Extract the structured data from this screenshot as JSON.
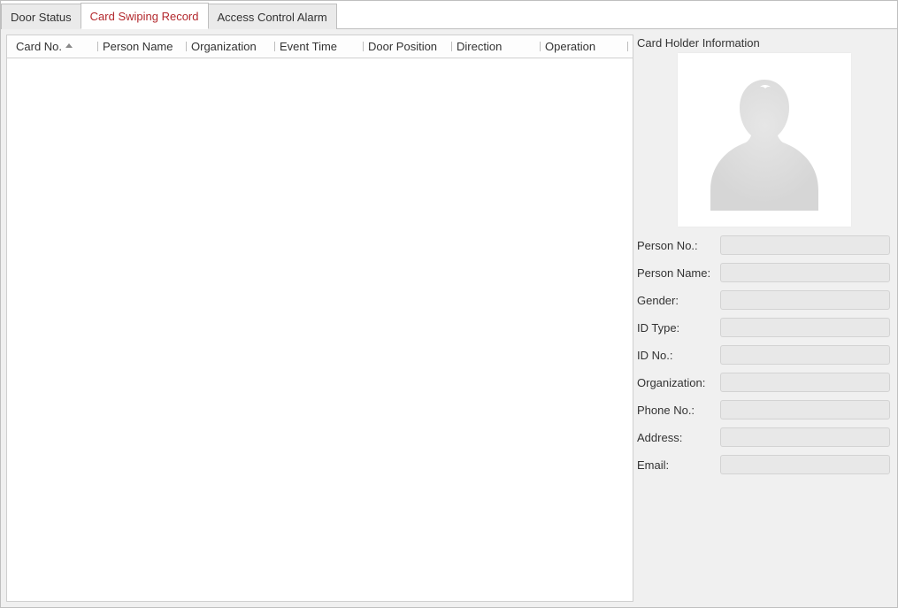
{
  "tabs": {
    "items": [
      {
        "label": "Door Status",
        "active": false
      },
      {
        "label": "Card Swiping Record",
        "active": true
      },
      {
        "label": "Access Control Alarm",
        "active": false
      }
    ]
  },
  "table": {
    "columns": [
      {
        "label": "Card No.",
        "sorted": true
      },
      {
        "label": "Person Name"
      },
      {
        "label": "Organization"
      },
      {
        "label": "Event Time"
      },
      {
        "label": "Door Position"
      },
      {
        "label": "Direction"
      },
      {
        "label": "Operation"
      }
    ],
    "rows": []
  },
  "side": {
    "title": "Card Holder Information",
    "avatar_icon": "person-silhouette",
    "fields": [
      {
        "label": "Person No.:",
        "value": ""
      },
      {
        "label": "Person Name:",
        "value": ""
      },
      {
        "label": "Gender:",
        "value": ""
      },
      {
        "label": "ID Type:",
        "value": ""
      },
      {
        "label": "ID No.:",
        "value": ""
      },
      {
        "label": "Organization:",
        "value": ""
      },
      {
        "label": "Phone No.:",
        "value": ""
      },
      {
        "label": "Address:",
        "value": ""
      },
      {
        "label": "Email:",
        "value": ""
      }
    ]
  }
}
